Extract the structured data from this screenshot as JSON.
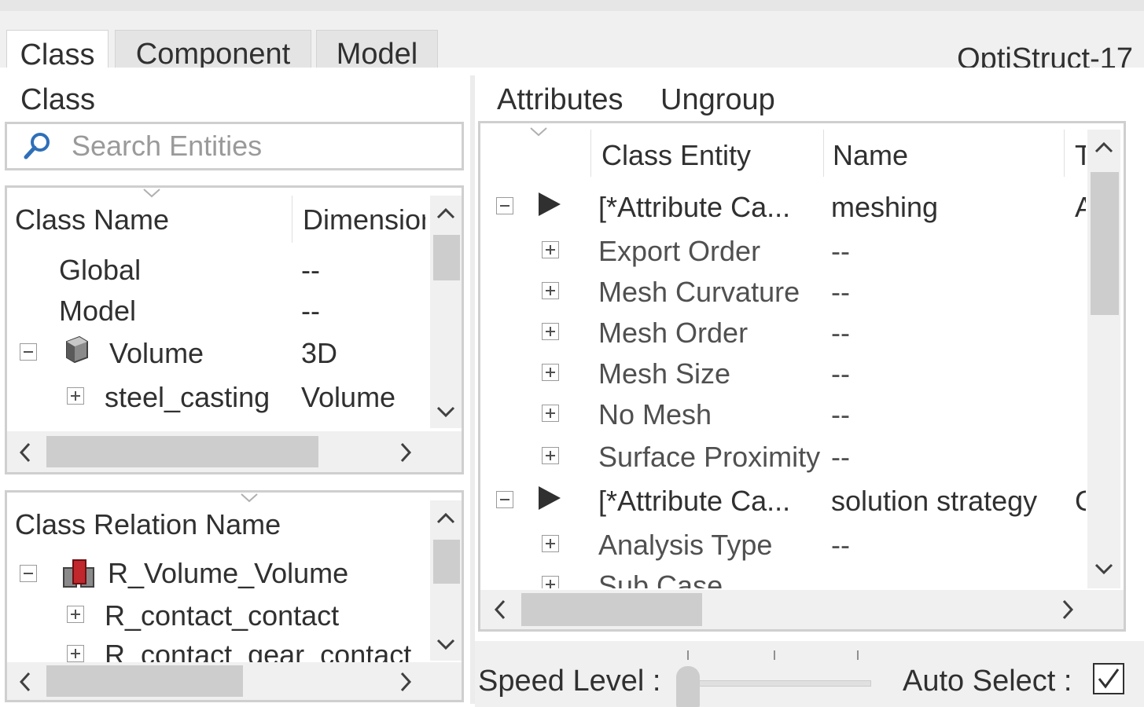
{
  "tabs": [
    {
      "label": "Class"
    },
    {
      "label": "Component"
    },
    {
      "label": "Model"
    }
  ],
  "solver_label": "OptiStruct-17",
  "class_panel": {
    "title": "Class",
    "search_placeholder": "Search Entities",
    "columns": [
      "Class Name",
      "Dimension"
    ],
    "rows": [
      {
        "name": "Global",
        "value": "--"
      },
      {
        "name": "Model",
        "value": "--"
      },
      {
        "name": "Volume",
        "value": "3D"
      },
      {
        "name": "steel_casting",
        "value": "Volume"
      }
    ]
  },
  "relation_panel": {
    "column": "Class Relation Name",
    "rows": [
      {
        "name": "R_Volume_Volume"
      },
      {
        "name": "R_contact_contact"
      },
      {
        "name": "R_contact_gear_contact"
      }
    ]
  },
  "attributes_panel": {
    "toolbar": {
      "attributes": "Attributes",
      "ungroup": "Ungroup"
    },
    "columns": [
      "Class Entity",
      "Name",
      "T"
    ],
    "rows": [
      {
        "entity": "[*Attribute Ca...",
        "name": "meshing",
        "type": "A"
      },
      {
        "entity": "Export Order",
        "name": "--"
      },
      {
        "entity": "Mesh Curvature",
        "name": "--"
      },
      {
        "entity": "Mesh Order",
        "name": "--"
      },
      {
        "entity": "Mesh Size",
        "name": "--"
      },
      {
        "entity": "No Mesh",
        "name": "--"
      },
      {
        "entity": "Surface Proximity",
        "name": "--"
      },
      {
        "entity": "[*Attribute Ca...",
        "name": "solution strategy",
        "type": "C"
      },
      {
        "entity": "Analysis Type",
        "name": "--"
      },
      {
        "entity": "Sub Case",
        "name": ""
      }
    ]
  },
  "footer": {
    "speed_level": "Speed Level :",
    "auto_select": "Auto Select :",
    "auto_select_checked": true
  },
  "icons": {
    "search": "search-icon",
    "volume": "cube-icon",
    "relation": "relation-icon"
  }
}
